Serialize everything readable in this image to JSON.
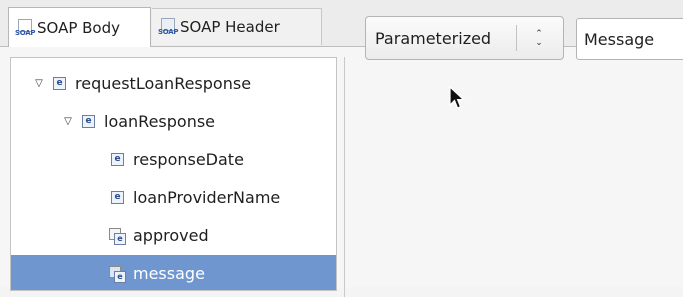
{
  "tabs": [
    {
      "label": "SOAP Body",
      "icon": "soap-body-icon",
      "active": true
    },
    {
      "label": "SOAP Header",
      "icon": "soap-header-icon",
      "active": false
    }
  ],
  "icon_text": {
    "soap": "SOAP"
  },
  "tree": {
    "nodes": [
      {
        "label": "requestLoanResponse",
        "kind": "element",
        "expanded": true,
        "depth": 0
      },
      {
        "label": "loanResponse",
        "kind": "element",
        "expanded": true,
        "depth": 1
      },
      {
        "label": "responseDate",
        "kind": "element",
        "depth": 2
      },
      {
        "label": "loanProviderName",
        "kind": "element",
        "depth": 2
      },
      {
        "label": "approved",
        "kind": "attribute-element",
        "depth": 2
      },
      {
        "label": "message",
        "kind": "attribute-element",
        "depth": 2,
        "selected": true
      }
    ],
    "element_glyph": "e"
  },
  "mode_select": {
    "value": "Parameterized"
  },
  "value_field": {
    "value": "Message"
  },
  "colors": {
    "selection": "#6f96cf",
    "icon_blue": "#2a4e8f"
  }
}
